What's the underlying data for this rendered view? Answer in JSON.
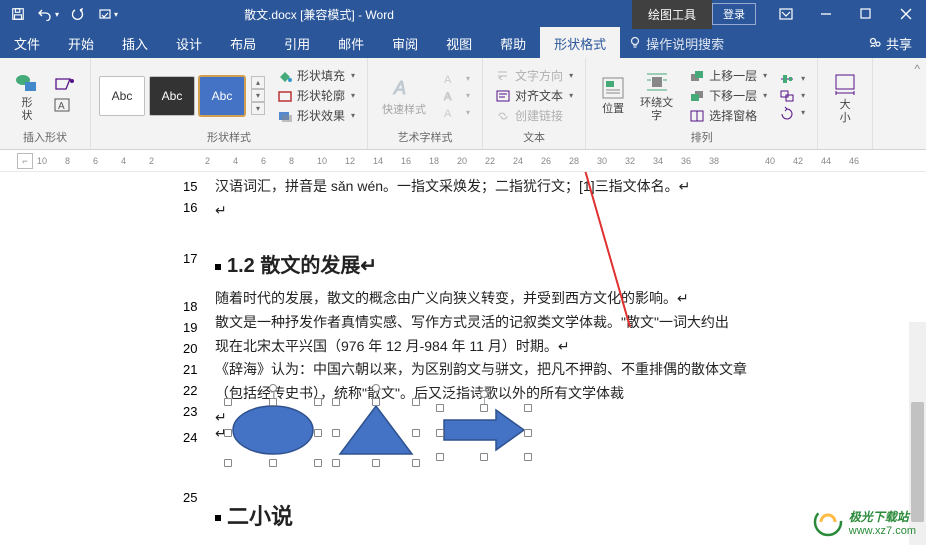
{
  "titlebar": {
    "filename": "散文.docx [兼容模式] - Word",
    "context_tab": "绘图工具",
    "login": "登录"
  },
  "tabs": {
    "items": [
      "文件",
      "开始",
      "插入",
      "设计",
      "布局",
      "引用",
      "邮件",
      "审阅",
      "视图",
      "帮助",
      "形状格式"
    ],
    "active_index": 10,
    "tell_me": "操作说明搜索",
    "share": "共享"
  },
  "ribbon": {
    "insert_shape": {
      "label": "形\n状",
      "group": "插入形状"
    },
    "shape_styles": {
      "group": "形状样式",
      "sample": "Abc",
      "fill": "形状填充",
      "outline": "形状轮廓",
      "effects": "形状效果"
    },
    "wordart": {
      "group": "艺术字样式",
      "quickstyle": "快速样式"
    },
    "text": {
      "group": "文本",
      "direction": "文字方向",
      "align": "对齐文本",
      "link": "创建链接"
    },
    "arrange": {
      "group": "排列",
      "position": "位置",
      "wrap": "环绕文\n字",
      "forward": "上移一层",
      "backward": "下移一层",
      "pane": "选择窗格"
    },
    "size": {
      "group": "大\n小"
    }
  },
  "ruler": {
    "marks": [
      "10",
      "8",
      "6",
      "4",
      "2",
      "",
      "2",
      "4",
      "6",
      "8",
      "10",
      "12",
      "14",
      "16",
      "18",
      "20",
      "22",
      "24",
      "26",
      "28",
      "30",
      "32",
      "34",
      "36",
      "38",
      "",
      "40",
      "42",
      "44",
      "46"
    ]
  },
  "doc": {
    "line_nums": [
      "15",
      "16",
      "17",
      "18",
      "19",
      "20",
      "21",
      "22",
      "23",
      "24",
      "25"
    ],
    "l15": "汉语词汇，拼音是 sǎn wén。一指文采焕发；二指犹行文；[1]三指文体名。↵",
    "l16": "↵",
    "h17": "1.2 散文的发展",
    "l18": "随着时代的发展，散文的概念由广义向狭义转变，并受到西方文化的影响。↵",
    "l19": "散文是一种抒发作者真情实感、写作方式灵活的记叙类文学体裁。\"散文\"一词大约出",
    "l20": "现在北宋太平兴国（976 年 12 月-984 年 11 月）时期。↵",
    "l21": "《辞海》认为：中国六朝以来，为区别韵文与骈文，把凡不押韵、不重排偶的散体文章",
    "l22": "（包括经传史书），统称\"散文\"。后又泛指诗歌以外的所有文学体裁",
    "l23": "↵",
    "l24": "↵",
    "h25": "二小说"
  },
  "watermark": {
    "line1": "极光下载站",
    "line2": "www.xz7.com"
  }
}
